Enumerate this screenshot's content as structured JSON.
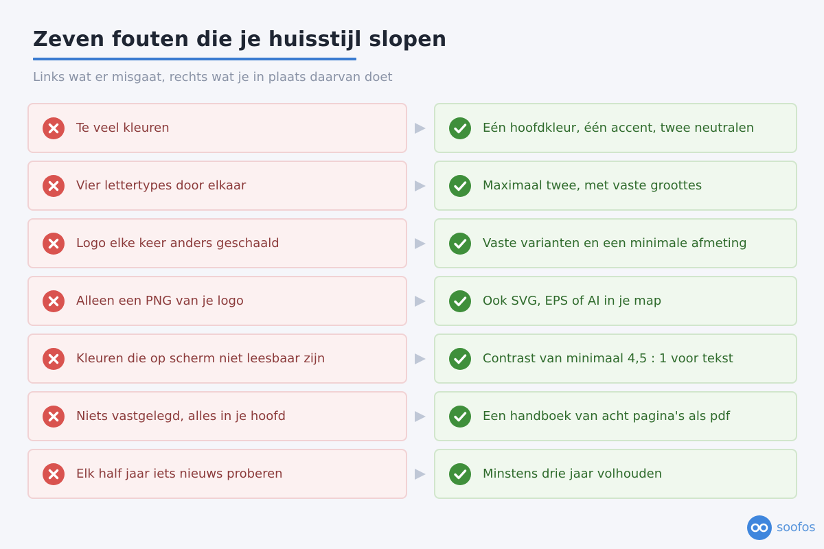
{
  "title": "Zeven fouten die je huisstijl slopen",
  "subtitle": "Links wat er misgaat, rechts wat je in plaats daarvan doet",
  "rows": [
    {
      "mistake": "Te veel kleuren",
      "fix": "Eén hoofdkleur, één accent, twee neutralen"
    },
    {
      "mistake": "Vier lettertypes door elkaar",
      "fix": "Maximaal twee, met vaste groottes"
    },
    {
      "mistake": "Logo elke keer anders geschaald",
      "fix": "Vaste varianten en een minimale afmeting"
    },
    {
      "mistake": "Alleen een PNG van je logo",
      "fix": "Ook SVG, EPS of AI in je map"
    },
    {
      "mistake": "Kleuren die op scherm niet leesbaar zijn",
      "fix": "Contrast van minimaal 4,5 : 1 voor tekst"
    },
    {
      "mistake": "Niets vastgelegd, alles in je hoofd",
      "fix": "Een handboek van acht pagina's als pdf"
    },
    {
      "mistake": "Elk half jaar iets nieuws proberen",
      "fix": "Minstens drie jaar volhouden"
    }
  ],
  "icons": {
    "mistake": "x-circle-icon",
    "fix": "check-circle-icon",
    "arrow": "triangle-right-icon"
  },
  "brand": {
    "name": "soofos",
    "logo_icon": "glasses-icon"
  },
  "colors": {
    "accent": "#3a7bd0",
    "mistake": "#d9534f",
    "fix": "#3f8f3b",
    "brand": "#5a96dc"
  }
}
